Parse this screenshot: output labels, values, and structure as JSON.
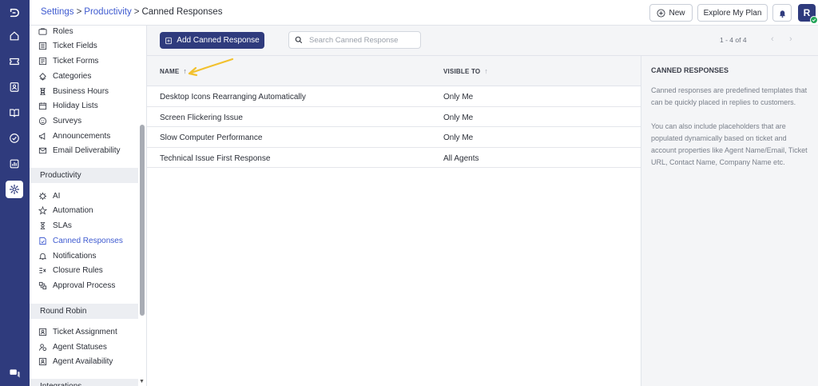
{
  "header": {
    "breadcrumb": {
      "settings": "Settings",
      "sep1": ">",
      "productivity": "Productivity",
      "sep2": ">",
      "current": "Canned Responses"
    },
    "new_label": "New",
    "plan_label": "Explore My Plan",
    "avatar_initial": "R"
  },
  "rail": {
    "icons": [
      "logo-icon",
      "home-icon",
      "ticket-icon",
      "contacts-icon",
      "knowledge-base-icon",
      "tasks-icon",
      "reports-icon",
      "settings-icon",
      "chat-icon"
    ],
    "active": "settings-icon",
    "color": "#2f3b7d"
  },
  "sidebar": {
    "items_top": [
      {
        "label": "Roles",
        "icon": "roles-icon"
      },
      {
        "label": "Ticket Fields",
        "icon": "ticket-fields-icon"
      },
      {
        "label": "Ticket Forms",
        "icon": "ticket-forms-icon"
      },
      {
        "label": "Categories",
        "icon": "categories-icon"
      },
      {
        "label": "Business Hours",
        "icon": "hourglass-icon"
      },
      {
        "label": "Holiday Lists",
        "icon": "calendar-icon"
      },
      {
        "label": "Surveys",
        "icon": "smiley-icon"
      },
      {
        "label": "Announcements",
        "icon": "megaphone-icon"
      },
      {
        "label": "Email Deliverability",
        "icon": "envelope-icon"
      }
    ],
    "section_productivity": "Productivity",
    "items_productivity": [
      {
        "label": "AI",
        "icon": "ai-icon"
      },
      {
        "label": "Automation",
        "icon": "automation-icon"
      },
      {
        "label": "SLAs",
        "icon": "sla-icon"
      },
      {
        "label": "Canned Responses",
        "icon": "canned-response-icon",
        "active": true
      },
      {
        "label": "Notifications",
        "icon": "bell-icon"
      },
      {
        "label": "Closure Rules",
        "icon": "closure-rules-icon"
      },
      {
        "label": "Approval Process",
        "icon": "approval-icon"
      }
    ],
    "section_round_robin": "Round Robin",
    "items_round_robin": [
      {
        "label": "Ticket Assignment",
        "icon": "ticket-assignment-icon"
      },
      {
        "label": "Agent Statuses",
        "icon": "agent-status-icon"
      },
      {
        "label": "Agent Availability",
        "icon": "agent-availability-icon"
      }
    ],
    "section_integrations": "Integrations"
  },
  "toolbar": {
    "add_label": "Add Canned Response",
    "search_placeholder": "Search Canned Response",
    "pager": "1 - 4 of 4",
    "prev": "‹",
    "next": "›"
  },
  "table": {
    "columns": [
      "NAME",
      "VISIBLE TO"
    ],
    "sort_arrow": "↑",
    "rows": [
      {
        "name": "Desktop Icons Rearranging Automatically",
        "visible_to": "Only Me"
      },
      {
        "name": "Screen Flickering Issue",
        "visible_to": "Only Me"
      },
      {
        "name": "Slow Computer Performance",
        "visible_to": "Only Me"
      },
      {
        "name": "Technical Issue First Response",
        "visible_to": "All Agents"
      }
    ]
  },
  "info": {
    "title": "CANNED RESPONSES",
    "p1": "Canned responses are predefined templates that can be quickly placed in replies to customers.",
    "p2": "You can also include placeholders that are populated dynamically based on ticket and account properties like Agent Name/Email, Ticket URL, Contact Name, Company Name etc."
  },
  "colors": {
    "brand": "#2f3b7d",
    "link": "#3f5bd0",
    "annotation_arrow": "#f2c12e",
    "online": "#22a559"
  }
}
